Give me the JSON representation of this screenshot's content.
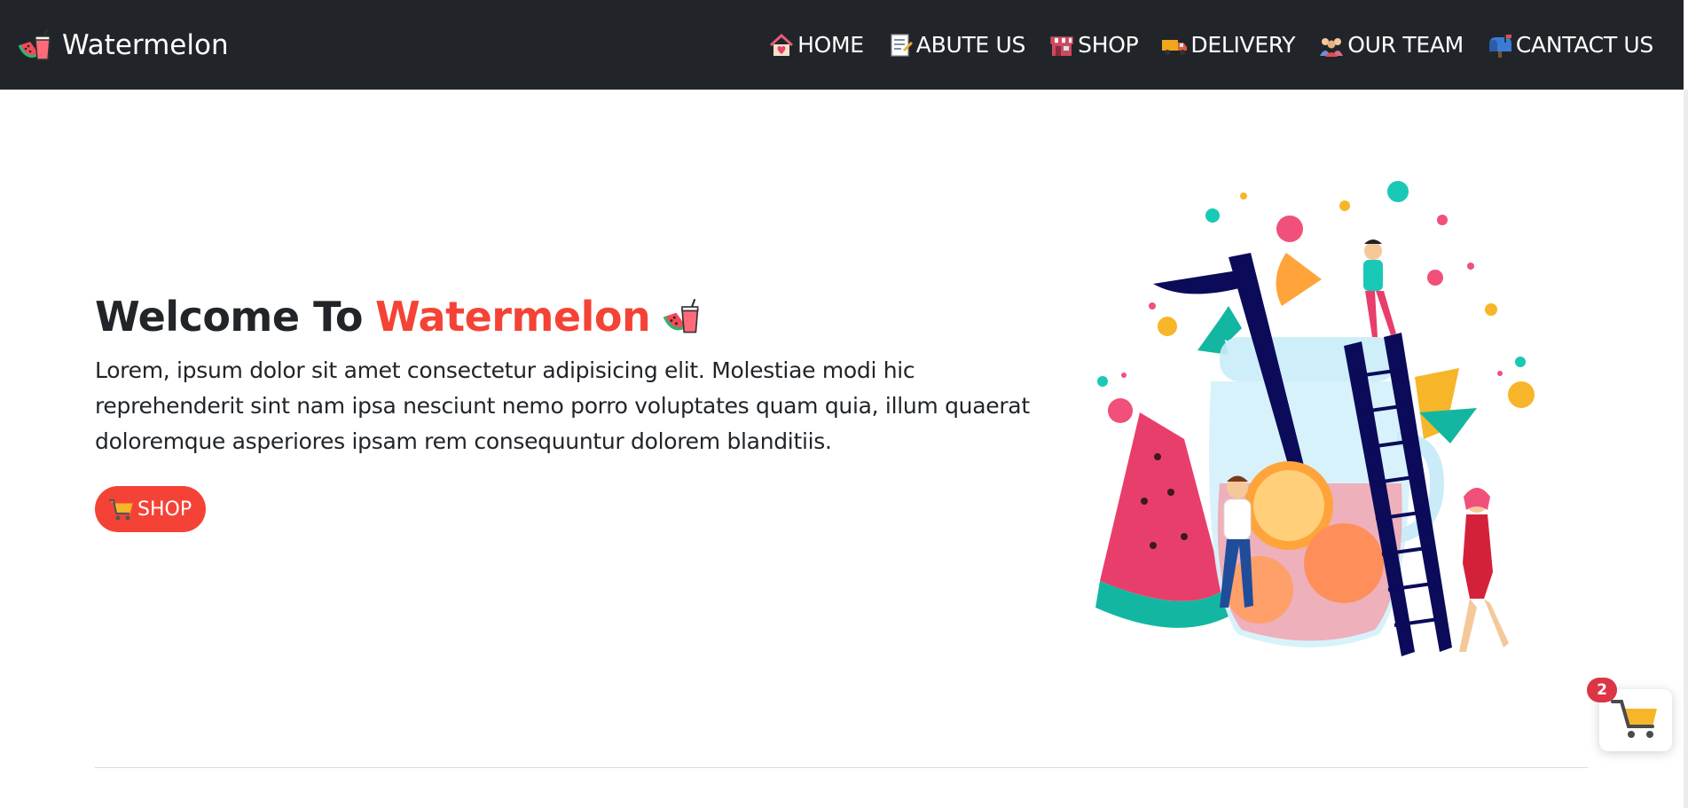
{
  "brand": {
    "name": "Watermelon",
    "icon": "watermelon-drink-icon"
  },
  "nav": {
    "items": [
      {
        "label": "HOME",
        "icon": "house-icon"
      },
      {
        "label": "ABUTE US",
        "icon": "document-icon"
      },
      {
        "label": "SHOP",
        "icon": "store-icon"
      },
      {
        "label": "DELIVERY",
        "icon": "delivery-truck-icon"
      },
      {
        "label": "OUR TEAM",
        "icon": "team-icon"
      },
      {
        "label": "CANTACT US",
        "icon": "mailbox-icon"
      }
    ]
  },
  "hero": {
    "title_prefix": "Welcome To",
    "title_accent": "Watermelon",
    "title_icon": "watermelon-drink-icon",
    "text": "Lorem, ipsum dolor sit amet consectetur adipisicing elit. Molestiae modi hic reprehenderit sint nam ipsa nesciunt nemo porro voluptates quam quia, illum quaerat doloremque asperiores ipsam rem consequuntur dolorem blanditiis.",
    "button_label": "SHOP",
    "button_icon": "shopping-cart-icon",
    "illustration": "lemonade-jar-illustration"
  },
  "cart": {
    "count": "2",
    "icon": "shopping-cart-icon"
  },
  "colors": {
    "nav_bg": "#212529",
    "accent": "#f44336",
    "badge": "#dc3545",
    "cart_yellow": "#f7b529"
  }
}
